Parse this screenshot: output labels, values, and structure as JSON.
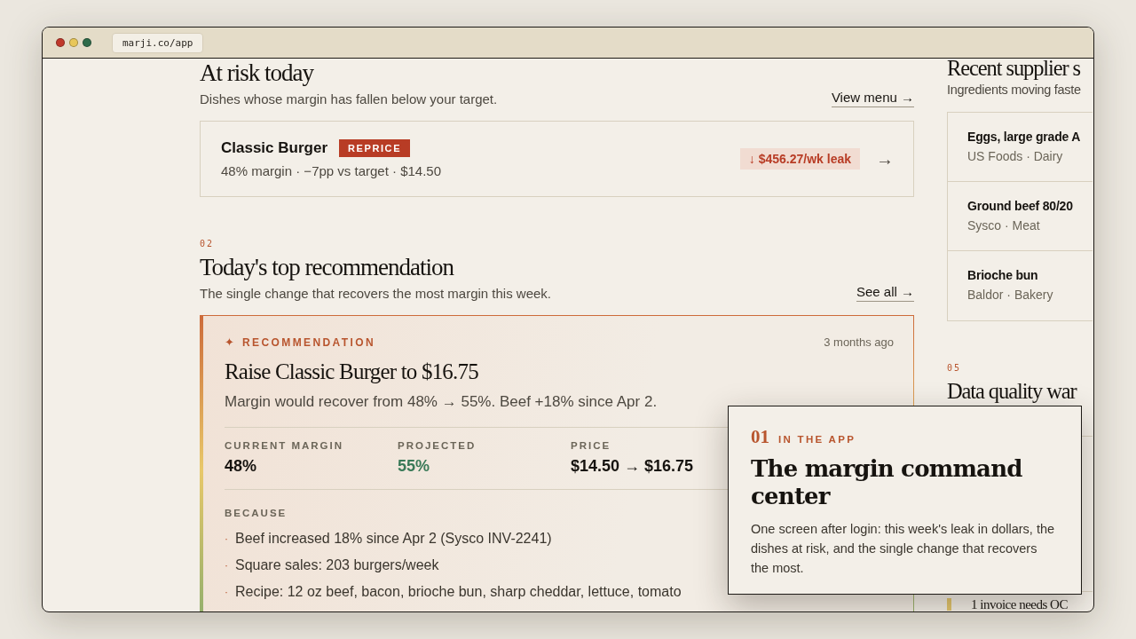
{
  "browser": {
    "url": "marji.co/app"
  },
  "at_risk": {
    "title": "At risk today",
    "subtitle": "Dishes whose margin has fallen below your target.",
    "link": "View menu →",
    "items": [
      {
        "name": "Classic Burger",
        "badge": "REPRICE",
        "meta": "48% margin · −7pp vs target · $14.50",
        "leak": "↓ $456.27/wk leak",
        "arrow": "→"
      }
    ]
  },
  "recommendation": {
    "number": "02",
    "title": "Today's top recommendation",
    "subtitle": "The single change that recovers the most margin this week.",
    "link": "See all →",
    "card": {
      "icon": "✦",
      "label": "RECOMMENDATION",
      "time": "3 months ago",
      "title": "Raise Classic Burger to $16.75",
      "description": "Margin would recover from 48% → 55%. Beef +18% since Apr 2.",
      "metrics": [
        {
          "label": "CURRENT MARGIN",
          "value": "48%",
          "highlighted": false
        },
        {
          "label": "PROJECTED",
          "value": "55%",
          "highlighted": true
        },
        {
          "label": "PRICE",
          "value": "$14.50 → $16.75",
          "highlighted": false
        }
      ],
      "because_label": "BECAUSE",
      "bullet": "·",
      "reasons": [
        "Beef increased 18% since Apr 2 (Sysco INV-2241)",
        "Square sales: 203 burgers/week",
        "Recipe: 12 oz beef, bacon, brioche bun, sharp cheddar, lettuce, tomato"
      ]
    }
  },
  "suppliers": {
    "title": "Recent supplier s",
    "subtitle": "Ingredients moving faste",
    "items": [
      {
        "name": "Eggs, large grade A",
        "meta": "US Foods · Dairy"
      },
      {
        "name": "Ground beef 80/20",
        "meta": "Sysco · Meat"
      },
      {
        "name": "Brioche bun",
        "meta": "Baldor · Bakery"
      }
    ]
  },
  "data_quality": {
    "number": "05",
    "title": "Data quality war",
    "alert": "1 invoice needs OC"
  },
  "callout": {
    "number": "01",
    "label": "IN THE APP",
    "title": "The margin command center",
    "body": "One screen after login: this week's leak in dollars, the dishes at risk, and the single change that recovers the most."
  }
}
